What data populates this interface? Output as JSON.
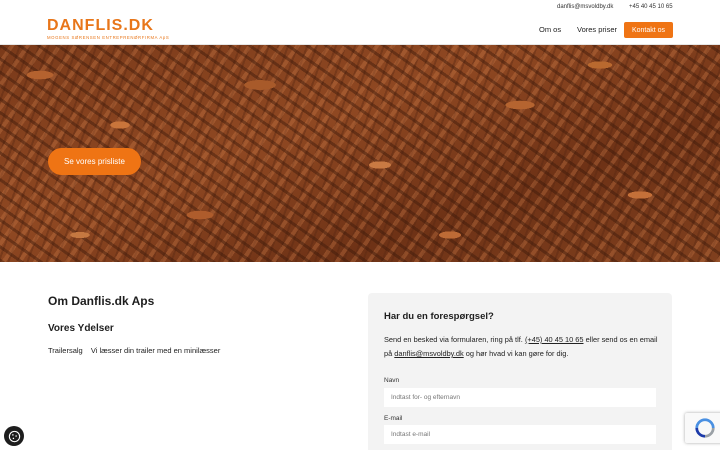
{
  "topbar": {
    "email": "danflis@msvoldby.dk",
    "phone": "+45 40 45 10 65"
  },
  "header": {
    "logo_main": "DANFLIS.DK",
    "logo_sub": "MOGENS SØRENSEN ENTREPRENØRFIRMA ApS",
    "nav": [
      {
        "label": "Om os"
      },
      {
        "label": "Vores priser"
      }
    ],
    "cta_label": "Kontakt os"
  },
  "hero": {
    "button_label": "Se vores prisliste"
  },
  "about": {
    "title": "Om Danflis.dk Aps",
    "services_title": "Vores Ydelser",
    "services": [
      {
        "name": "Trailersalg",
        "description": "Vi læsser din trailer med en minilæsser"
      }
    ]
  },
  "contact": {
    "title": "Har du en forespørgsel?",
    "text_1": "Send en besked via formularen, ring på tlf.",
    "phone_link": "(+45) 40 45 10 65",
    "text_2": "eller send os en email på",
    "email_link": "danflis@msvoldby.dk",
    "text_3": "og hør hvad vi kan gøre for dig.",
    "name_label": "Navn",
    "name_placeholder": "Indtast for- og efternavn",
    "email_label": "E-mail",
    "email_placeholder": "Indtast e-mail"
  },
  "colors": {
    "accent": "#ef7414",
    "card_bg": "#f3f3f3"
  },
  "icons": {
    "cookie": "cookie-icon",
    "recaptcha": "recaptcha-icon"
  }
}
